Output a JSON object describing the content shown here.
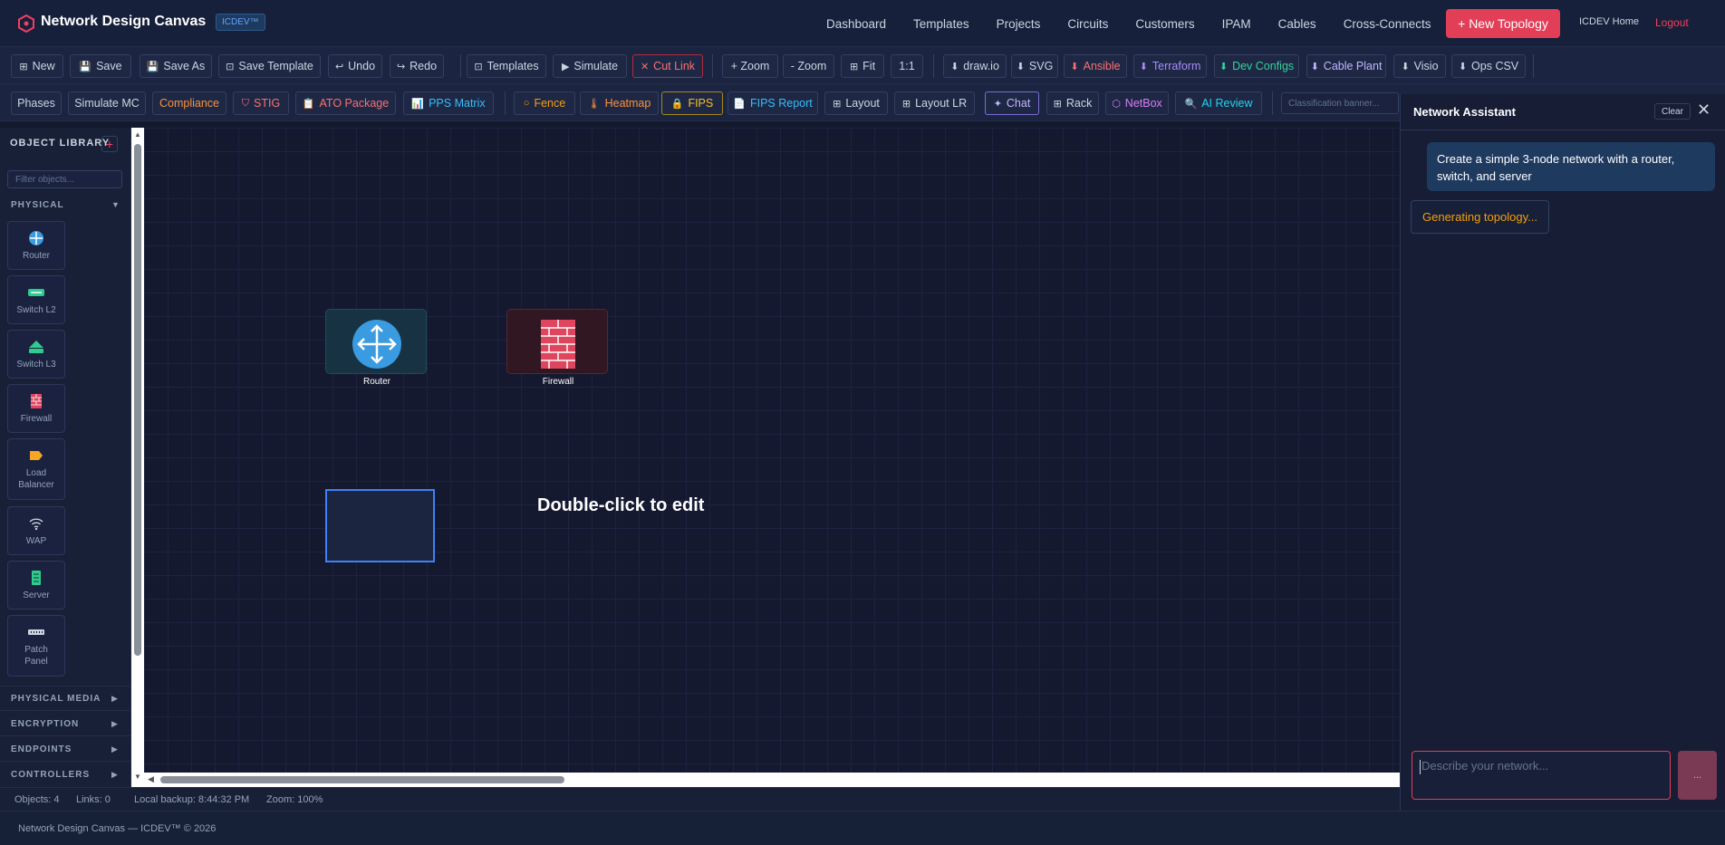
{
  "app": {
    "title": "Network Design Canvas",
    "badge": "ICDEV™",
    "brand_icon": "hexagon-icon",
    "accent": "#e23e57"
  },
  "nav": {
    "links": [
      "Dashboard",
      "Templates",
      "Projects",
      "Circuits",
      "Customers",
      "IPAM",
      "Cables",
      "Cross-Connects"
    ],
    "new_topology": "+ New Topology",
    "home": "ICDEV Home",
    "logout": "Logout"
  },
  "toolbar1": {
    "new": "New",
    "save": "Save",
    "save_as": "Save As",
    "save_template": "Save Template",
    "undo": "Undo",
    "redo": "Redo",
    "templates": "Templates",
    "simulate": "Simulate",
    "cut_link": "Cut Link",
    "zoom_in": "+ Zoom",
    "zoom_out": "- Zoom",
    "fit": "Fit",
    "one_to_one": "1:1",
    "drawio": "draw.io",
    "svg": "SVG",
    "ansible": "Ansible",
    "terraform": "Terraform",
    "dev_configs": "Dev Configs",
    "cable_plant": "Cable Plant",
    "visio": "Visio",
    "ops_csv": "Ops CSV"
  },
  "toolbar2": {
    "phases": "Phases",
    "simulate_mc": "Simulate MC",
    "compliance": "Compliance",
    "stig": "STIG",
    "ato_package": "ATO Package",
    "pps_matrix": "PPS Matrix",
    "fence": "Fence",
    "heatmap": "Heatmap",
    "fips": "FIPS",
    "fips_report": "FIPS Report",
    "layout": "Layout",
    "layout_lr": "Layout LR",
    "chat": "Chat",
    "rack": "Rack",
    "netbox": "NetBox",
    "ai_review": "AI Review",
    "classification_placeholder": "Classification banner..."
  },
  "sidebar": {
    "title": "OBJECT LIBRARY",
    "add": "+",
    "filter_placeholder": "Filter objects...",
    "physical": "PHYSICAL",
    "objects": [
      "Router",
      "Switch L2",
      "Switch L3",
      "Firewall",
      "Load Balancer",
      "WAP",
      "Server",
      "Patch Panel"
    ],
    "categories": [
      "PHYSICAL MEDIA",
      "ENCRYPTION",
      "ENDPOINTS",
      "CONTROLLERS"
    ]
  },
  "canvas": {
    "nodes": [
      {
        "label": "Router",
        "icon": "router-icon"
      },
      {
        "label": "Firewall",
        "icon": "firewall-icon"
      }
    ],
    "edit_hint": "Double-click to edit"
  },
  "assistant": {
    "title": "Network Assistant",
    "clear": "Clear",
    "user_message": "Create a simple 3-node network with a router, switch, and server",
    "bot_message": "Generating topology...",
    "input_placeholder": "Describe your network...",
    "send": "..."
  },
  "status": {
    "objects": "Objects: 4",
    "links": "Links: 0",
    "backup": "Local backup: 8:44:32 PM",
    "zoom": "Zoom: 100%"
  },
  "footer": {
    "text": "Network Design Canvas — ICDEV™ © 2026"
  }
}
